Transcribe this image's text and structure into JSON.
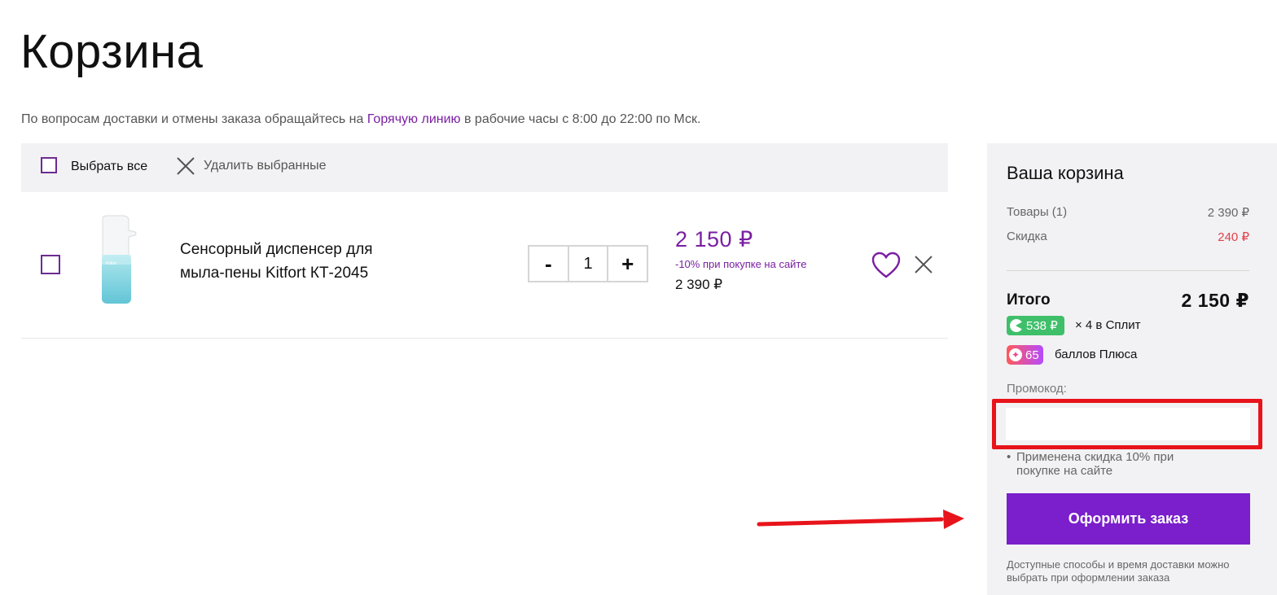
{
  "page": {
    "title": "Корзина",
    "notice_before": "По вопросам доставки и отмены заказа обращайтесь на ",
    "notice_link": "Горячую линию",
    "notice_after": " в рабочие часы с 8:00 до 22:00 по Мск."
  },
  "toolbar": {
    "select_all": "Выбрать все",
    "delete_selected": "Удалить выбранные"
  },
  "cart_items": [
    {
      "name_line1": "Сенсорный диспенсер для",
      "name_line2": "мыла-пены Kitfort КТ-2045",
      "quantity": "1",
      "minus": "-",
      "plus": "+",
      "price_new": "2 150 ₽",
      "discount_note": "-10% при покупке на сайте",
      "price_old": "2 390 ₽",
      "image_brand_text": "Kitfort"
    }
  ],
  "summary": {
    "title": "Ваша корзина",
    "goods_label": "Товары (1)",
    "goods_value": "2 390 ₽",
    "discount_label": "Скидка",
    "discount_value": "240 ₽",
    "total_label": "Итого",
    "total_value": "2 150 ₽",
    "split_amount": "538 ₽",
    "split_text": "× 4 в Сплит",
    "plus_points": "65",
    "plus_text": "баллов Плюса",
    "promo_label": "Промокод:",
    "promo_value": "",
    "promo_note": "Применена скидка 10% при покупке на сайте",
    "checkout_button": "Оформить заказ",
    "delivery_note": "Доступные способы и время доставки можно выбрать при оформлении заказа"
  },
  "colors": {
    "accent": "#7a1fcb",
    "price": "#7a1fa2",
    "discount": "#e0424a",
    "highlight": "#e8141b",
    "split": "#3fbf6a"
  }
}
